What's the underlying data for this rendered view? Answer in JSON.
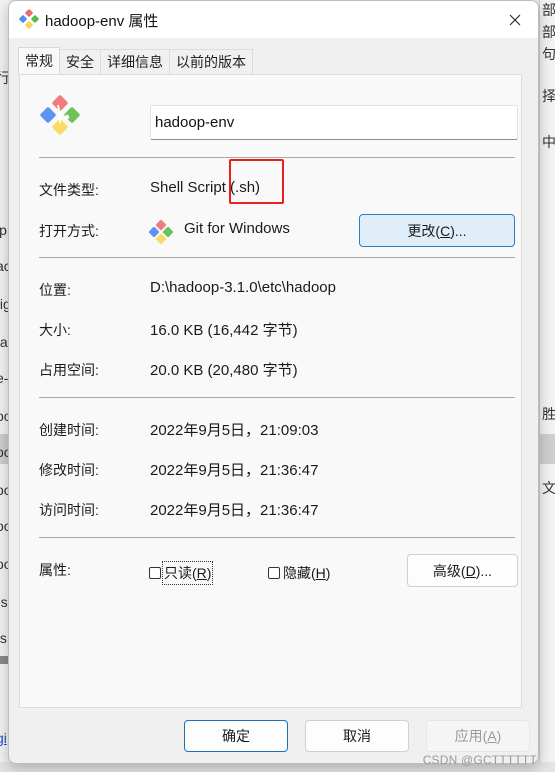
{
  "background": {
    "left_fragments": [
      "行",
      "lp",
      "ac",
      "fig",
      "ta",
      "e-",
      "oo",
      "oo",
      "oo",
      "oo",
      "oo",
      "-s",
      "fs",
      "gi"
    ],
    "right_fragments": [
      "部",
      "部",
      "句",
      "择",
      "中",
      "胜",
      "文"
    ]
  },
  "window": {
    "title": "hadoop-env 属性",
    "close_icon": "close-icon"
  },
  "tabs": [
    {
      "label": "常规",
      "active": true
    },
    {
      "label": "安全",
      "active": false
    },
    {
      "label": "详细信息",
      "active": false
    },
    {
      "label": "以前的版本",
      "active": false
    }
  ],
  "general": {
    "file_name": "hadoop-env",
    "file_type_label": "文件类型:",
    "file_type_value": "Shell Script (.sh)",
    "opens_with_label": "打开方式:",
    "opens_with_value": "Git for Windows",
    "change_button": {
      "text": "更改(",
      "key": "C",
      "suffix": ")..."
    },
    "location_label": "位置:",
    "location_value": "D:\\hadoop-3.1.0\\etc\\hadoop",
    "size_label": "大小:",
    "size_value": "16.0 KB (16,442 字节)",
    "size_on_disk_label": "占用空间:",
    "size_on_disk_value": "20.0 KB (20,480 字节)",
    "created_label": "创建时间:",
    "created_value": "2022年9月5日，21:09:03",
    "modified_label": "修改时间:",
    "modified_value": "2022年9月5日，21:36:47",
    "accessed_label": "访问时间:",
    "accessed_value": "2022年9月5日，21:36:47",
    "attributes_label": "属性:",
    "readonly": {
      "text": "只读(",
      "key": "R",
      "suffix": ")",
      "checked": false
    },
    "hidden": {
      "text": "隐藏(",
      "key": "H",
      "suffix": ")",
      "checked": false
    },
    "advanced_button": {
      "text": "高级(",
      "key": "D",
      "suffix": ")..."
    }
  },
  "footer": {
    "ok": "确定",
    "cancel": "取消",
    "apply": {
      "text": "应用(",
      "key": "A",
      "suffix": ")"
    }
  },
  "annotation": {
    "highlight_color": "#e8201b",
    "highlighted_text": "(.sh)"
  },
  "watermark": "CSDN @GCTTTTTT",
  "colors": {
    "accent": "#2f7bc4",
    "change_button_bg": "#e0eef9"
  }
}
